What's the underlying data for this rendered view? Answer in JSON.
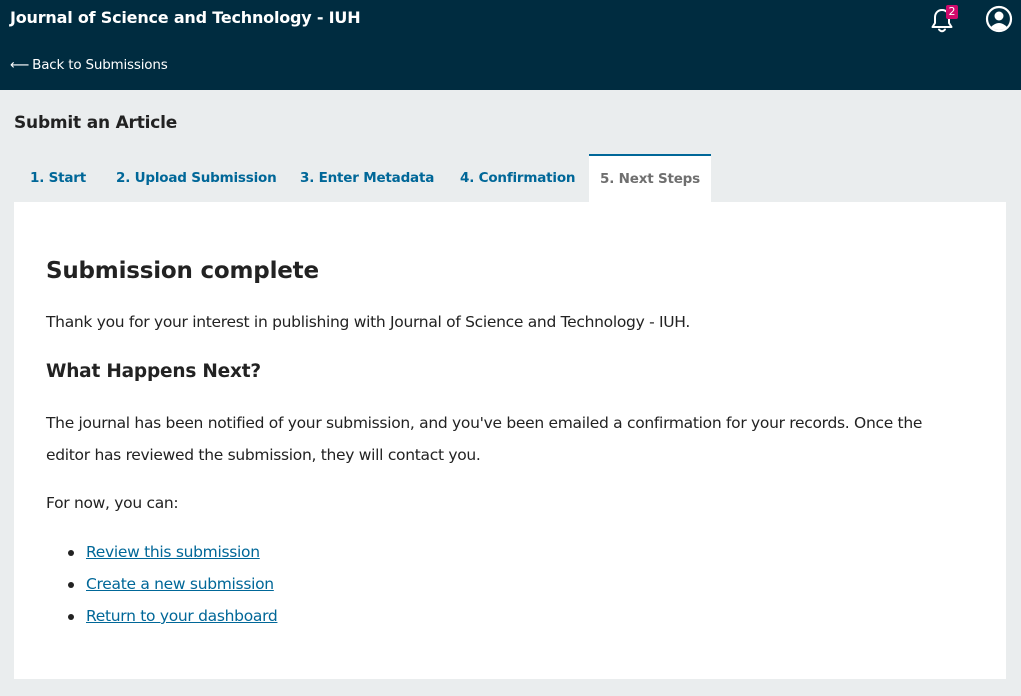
{
  "header": {
    "site_title": "Journal of Science and Technology - IUH",
    "back_arrow": "⟵",
    "back_label": "Back to Submissions",
    "notification_count": "2",
    "brand_color": "#002c40"
  },
  "page": {
    "title": "Submit an Article"
  },
  "tabs": [
    {
      "label": "1. Start"
    },
    {
      "label": "2. Upload Submission"
    },
    {
      "label": "3. Enter Metadata"
    },
    {
      "label": "4. Confirmation"
    },
    {
      "label": "5. Next Steps",
      "active": true
    }
  ],
  "content": {
    "heading": "Submission complete",
    "thank_you": "Thank you for your interest in publishing with Journal of Science and Technology - IUH.",
    "subheading": "What Happens Next?",
    "notice_line1": "The journal has been notified of your submission, and you've been emailed a confirmation for your records. Once the",
    "notice_line2": "editor has reviewed the submission, they will contact you.",
    "for_now": "For now, you can:",
    "links": [
      {
        "label": "Review this submission"
      },
      {
        "label": "Create a new submission"
      },
      {
        "label": "Return to your dashboard"
      }
    ]
  },
  "icons": {
    "notifications": "bell-icon",
    "user": "user-circle-icon"
  },
  "colors": {
    "accent": "#006798",
    "badge": "#d00a6c",
    "background": "#eaedee"
  }
}
